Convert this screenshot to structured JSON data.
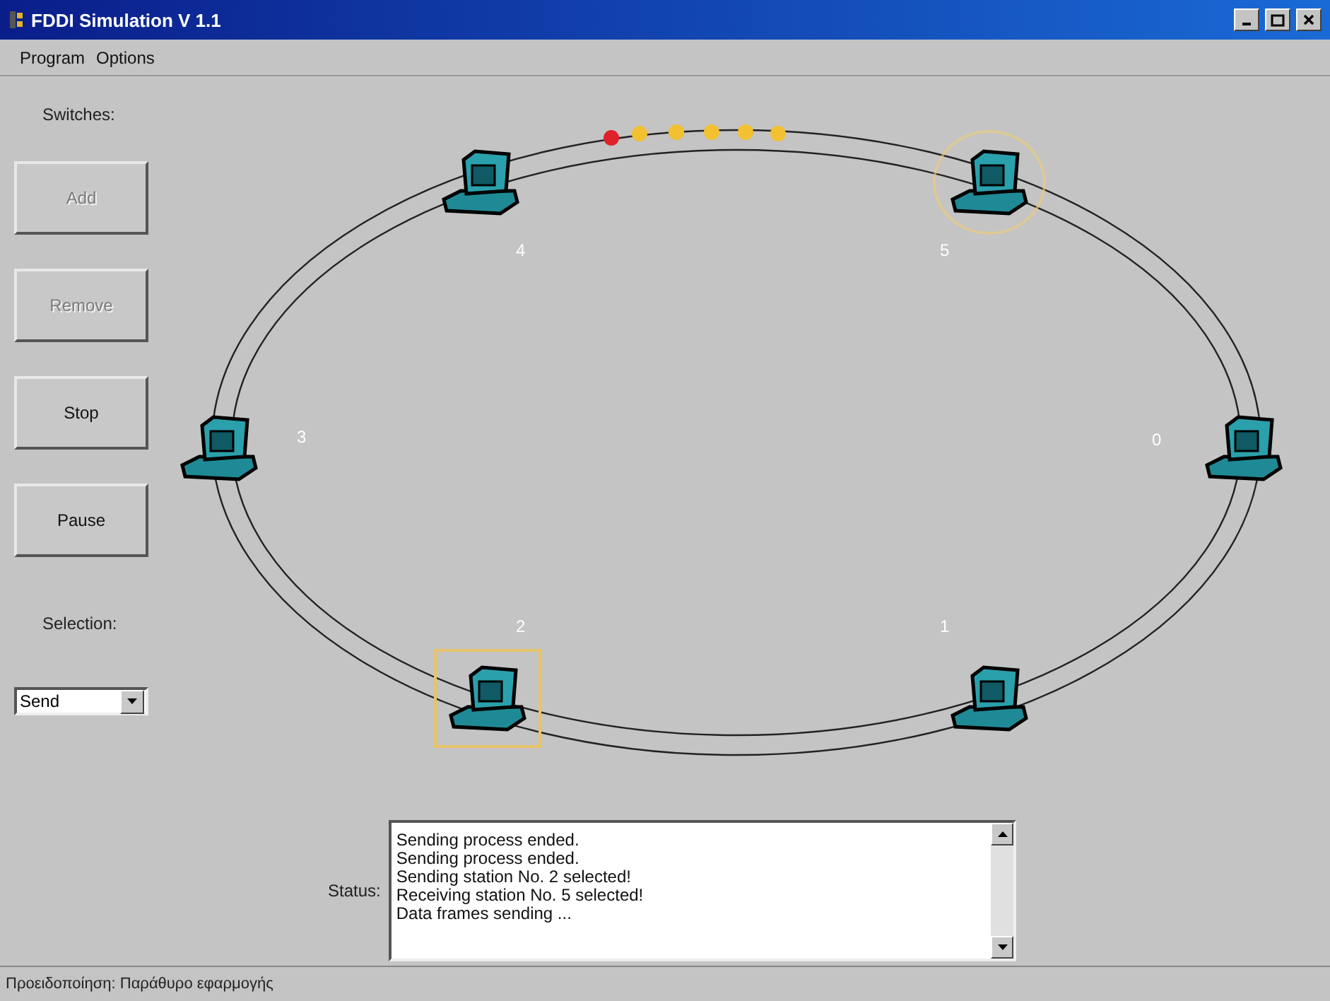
{
  "window": {
    "title": "FDDI Simulation V 1.1"
  },
  "menu": [
    {
      "label": "Program"
    },
    {
      "label": "Options"
    }
  ],
  "switches_label": "Switches:",
  "buttons": [
    {
      "label": "Add",
      "disabled": true
    },
    {
      "label": "Remove",
      "disabled": true
    },
    {
      "label": "Stop",
      "disabled": false
    },
    {
      "label": "Pause",
      "disabled": false
    }
  ],
  "selection": {
    "label": "Selection:",
    "value": "Send"
  },
  "stations": [
    {
      "label": "0",
      "sending": false,
      "receiving": false
    },
    {
      "label": "1",
      "sending": false,
      "receiving": false
    },
    {
      "label": "2",
      "sending": true,
      "receiving": false
    },
    {
      "label": "3",
      "sending": false,
      "receiving": false
    },
    {
      "label": "4",
      "sending": false,
      "receiving": false
    },
    {
      "label": "5",
      "sending": false,
      "receiving": true
    }
  ],
  "frames": [
    {
      "kind": "token"
    },
    {
      "kind": "data"
    },
    {
      "kind": "data"
    },
    {
      "kind": "data"
    },
    {
      "kind": "data"
    },
    {
      "kind": "data"
    }
  ],
  "status": {
    "label": "Status:",
    "lines": [
      "Sending process ended.",
      "Sending process ended.",
      "Sending station No. 2 selected!",
      "Receiving station No. 5 selected!",
      "Data frames sending ..."
    ]
  },
  "status_bar": "Προειδοποίηση: Παράθυρο εφαρμογής"
}
